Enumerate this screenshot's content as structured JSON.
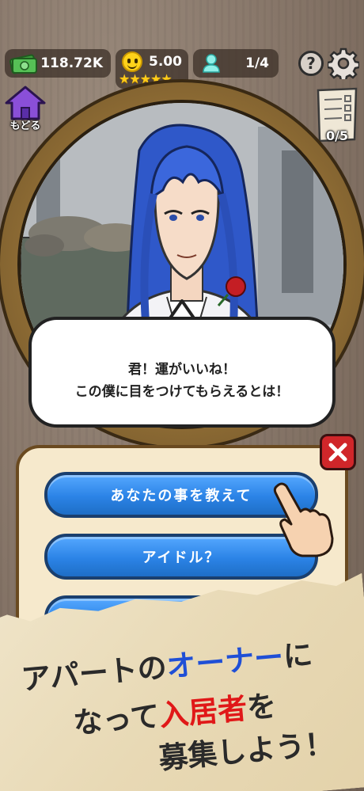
{
  "hud": {
    "money": "118.72K",
    "rating": "5.00",
    "stars": "★★★★★",
    "tenants": "1/4",
    "help_symbol": "?"
  },
  "nav": {
    "back_label": "もどる",
    "checklist_count": "0/5"
  },
  "dialogue": {
    "line1": "君！運がいいね！",
    "line2": "この僕に目をつけてもらえるとは！"
  },
  "choices": [
    {
      "label": "あなたの事を教えて"
    },
    {
      "label": "アイドル？"
    },
    {
      "label": ""
    }
  ],
  "promo": {
    "line1_a": "アパートの",
    "line1_b": "オーナー",
    "line1_c": "に",
    "line2_a": "なって",
    "line2_b": "入居者",
    "line2_c": "を",
    "line3": "募集しよう！"
  },
  "colors": {
    "choice_blue": "#2b83e6",
    "close_red": "#d0262a",
    "promo_blue": "#1f4fd6",
    "promo_red": "#e01818",
    "star_gold": "#ffcc1a"
  },
  "icons": [
    "money-icon",
    "smile-icon",
    "person-icon",
    "help-icon",
    "gear-icon",
    "home-icon",
    "checklist-icon",
    "close-icon",
    "pointing-hand-icon"
  ]
}
